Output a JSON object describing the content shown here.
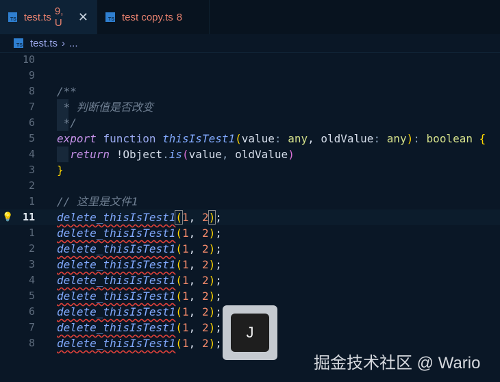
{
  "tabs": [
    {
      "icon": "TS",
      "name": "test.ts",
      "badge": "9, U",
      "active": true
    },
    {
      "icon": "TS",
      "name": "test copy.ts",
      "badge": "8",
      "active": false
    }
  ],
  "close_glyph": "✕",
  "breadcrumb": {
    "icon": "TS",
    "file": "test.ts",
    "sep": "›",
    "more": "..."
  },
  "lines": [
    {
      "num": "10",
      "tokens": []
    },
    {
      "num": "9",
      "tokens": []
    },
    {
      "num": "8",
      "tokens": [
        [
          "c-comment",
          "/**"
        ]
      ]
    },
    {
      "num": "7",
      "guide": true,
      "tokens": [
        [
          "c-comment",
          " * 判断值是否改变"
        ]
      ]
    },
    {
      "num": "6",
      "guide": true,
      "tokens": [
        [
          "c-comment",
          " */"
        ]
      ]
    },
    {
      "num": "5",
      "tokens": [
        [
          "c-kw",
          "export"
        ],
        [
          "",
          " "
        ],
        [
          "c-fn-kw",
          "function"
        ],
        [
          "",
          " "
        ],
        [
          "c-fn",
          "thisIsTest1"
        ],
        [
          "c-br",
          "("
        ],
        [
          "",
          "value"
        ],
        [
          "c-punc",
          ":"
        ],
        [
          "",
          " "
        ],
        [
          "c-type",
          "any"
        ],
        [
          "",
          ", oldValue"
        ],
        [
          "c-punc",
          ":"
        ],
        [
          "",
          " "
        ],
        [
          "c-type",
          "any"
        ],
        [
          "c-br",
          ")"
        ],
        [
          "c-punc",
          ":"
        ],
        [
          "",
          " "
        ],
        [
          "c-type",
          "boolean"
        ],
        [
          "",
          " "
        ],
        [
          "c-br",
          "{"
        ]
      ]
    },
    {
      "num": "4",
      "guide": true,
      "tokens": [
        [
          "",
          "  "
        ],
        [
          "c-kw",
          "return"
        ],
        [
          "",
          ""
        ],
        [
          "",
          " !Object"
        ],
        [
          "c-punc",
          "."
        ],
        [
          "c-fn",
          "is"
        ],
        [
          "c-br2",
          "("
        ],
        [
          "",
          "value"
        ],
        [
          "c-punc",
          ","
        ],
        [
          "",
          " oldValue"
        ],
        [
          "c-br2",
          ")"
        ]
      ]
    },
    {
      "num": "3",
      "tokens": [
        [
          "c-br",
          "}"
        ]
      ]
    },
    {
      "num": "2",
      "tokens": []
    },
    {
      "num": "1",
      "tokens": [
        [
          "c-comment",
          "// 这里是文件1"
        ]
      ]
    },
    {
      "num": "11",
      "current": true,
      "tokens": [
        [
          "c-err",
          "delete_thisIsTest1"
        ],
        [
          "c-br c-cur",
          "("
        ],
        [
          "c-num",
          "1"
        ],
        [
          "",
          ", "
        ],
        [
          "c-num",
          "2"
        ],
        [
          "c-br c-cur",
          ")"
        ],
        [
          "",
          ";"
        ]
      ]
    },
    {
      "num": "1",
      "tokens": [
        [
          "c-err",
          "delete_thisIsTest1"
        ],
        [
          "c-br",
          "("
        ],
        [
          "c-num",
          "1"
        ],
        [
          "",
          ", "
        ],
        [
          "c-num",
          "2"
        ],
        [
          "c-br",
          ")"
        ],
        [
          "",
          ";"
        ]
      ]
    },
    {
      "num": "2",
      "tokens": [
        [
          "c-err",
          "delete_thisIsTest1"
        ],
        [
          "c-br",
          "("
        ],
        [
          "c-num",
          "1"
        ],
        [
          "",
          ", "
        ],
        [
          "c-num",
          "2"
        ],
        [
          "c-br",
          ")"
        ],
        [
          "",
          ";"
        ]
      ]
    },
    {
      "num": "3",
      "tokens": [
        [
          "c-err",
          "delete_thisIsTest1"
        ],
        [
          "c-br",
          "("
        ],
        [
          "c-num",
          "1"
        ],
        [
          "",
          ", "
        ],
        [
          "c-num",
          "2"
        ],
        [
          "c-br",
          ")"
        ],
        [
          "",
          ";"
        ]
      ]
    },
    {
      "num": "4",
      "tokens": [
        [
          "c-err",
          "delete_thisIsTest1"
        ],
        [
          "c-br",
          "("
        ],
        [
          "c-num",
          "1"
        ],
        [
          "",
          ", "
        ],
        [
          "c-num",
          "2"
        ],
        [
          "c-br",
          ")"
        ],
        [
          "",
          ";"
        ]
      ]
    },
    {
      "num": "5",
      "tokens": [
        [
          "c-err",
          "delete_thisIsTest1"
        ],
        [
          "c-br",
          "("
        ],
        [
          "c-num",
          "1"
        ],
        [
          "",
          ", "
        ],
        [
          "c-num",
          "2"
        ],
        [
          "c-br",
          ")"
        ],
        [
          "",
          ";"
        ]
      ]
    },
    {
      "num": "6",
      "tokens": [
        [
          "c-err",
          "delete_thisIsTest1"
        ],
        [
          "c-br",
          "("
        ],
        [
          "c-num",
          "1"
        ],
        [
          "",
          ", "
        ],
        [
          "c-num",
          "2"
        ],
        [
          "c-br",
          ")"
        ],
        [
          "",
          ";"
        ]
      ]
    },
    {
      "num": "7",
      "tokens": [
        [
          "c-err",
          "delete_thisIsTest1"
        ],
        [
          "c-br",
          "("
        ],
        [
          "c-num",
          "1"
        ],
        [
          "",
          ", "
        ],
        [
          "c-num",
          "2"
        ],
        [
          "c-br",
          ")"
        ],
        [
          "",
          ";"
        ]
      ]
    },
    {
      "num": "8",
      "tokens": [
        [
          "c-err",
          "delete_thisIsTest1"
        ],
        [
          "c-br",
          "("
        ],
        [
          "c-num",
          "1"
        ],
        [
          "",
          ", "
        ],
        [
          "c-num",
          "2"
        ],
        [
          "c-br",
          ")"
        ],
        [
          "",
          ";"
        ]
      ]
    }
  ],
  "keypress": "J",
  "watermark": "掘金技术社区 @ Wario"
}
